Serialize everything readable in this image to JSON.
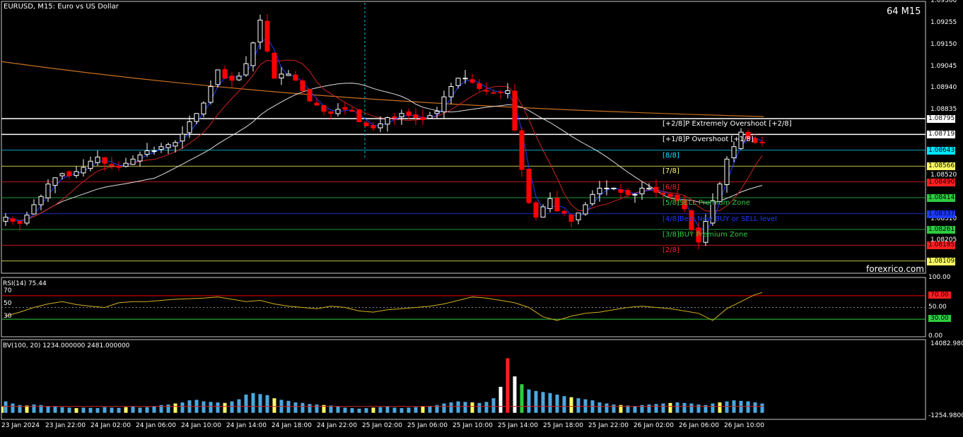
{
  "chart_title": "EURUSD, M15:  Euro vs US Dollar",
  "timeframe_badge": "64 M15",
  "watermark": "forexrico.com",
  "colors": {
    "background": "#000000",
    "bull": "#ffffff",
    "bear": "#ff0000",
    "ma_red": "#cc2222",
    "ma_orange": "#c87020",
    "ma_white": "#dddddd",
    "ma_blue": "#1a3cff",
    "rsi_line": "#d4b020",
    "rsi_70": "#ff0000",
    "rsi_30": "#2ecc40"
  },
  "price_axis": [
    "1.09360",
    "1.09255",
    "1.09150",
    "1.09045",
    "1.08940",
    "1.08835",
    "1.08520",
    "1.08310",
    "1.08205"
  ],
  "price_labels": [
    {
      "text": "1.08795",
      "bg": "#ffffff",
      "fg": "#000000"
    },
    {
      "text": "1.08719",
      "bg": "#ffffff",
      "fg": "#000000"
    },
    {
      "text": "1.08643",
      "bg": "#00e5ff",
      "fg": "#000000"
    },
    {
      "text": "1.08566",
      "bg": "#ffff66",
      "fg": "#000000"
    },
    {
      "text": "1.08490",
      "bg": "#ff2020",
      "fg": "#000000"
    },
    {
      "text": "1.08414",
      "bg": "#2ecc40",
      "fg": "#000000"
    },
    {
      "text": "1.08337",
      "bg": "#1a3cff",
      "fg": "#000000"
    },
    {
      "text": "1.08261",
      "bg": "#2ecc40",
      "fg": "#000000"
    },
    {
      "text": "1.08185",
      "bg": "#ff2020",
      "fg": "#000000"
    },
    {
      "text": "1.08109",
      "bg": "#ffff66",
      "fg": "#000000"
    }
  ],
  "murrey_levels": [
    {
      "label": "[+2/8]P Extremely Overshoot [+2/8]",
      "color": "#ffffff"
    },
    {
      "label": "[+1/8]P Overshoot [+1/8]",
      "color": "#ffffff"
    },
    {
      "label": "[8/8]",
      "color": "#00e5ff"
    },
    {
      "label": "[7/8]",
      "color": "#ffff66"
    },
    {
      "label": "[6/8]",
      "color": "#ff2020"
    },
    {
      "label": "[5/8]SELL Premium Zone",
      "color": "#2ecc40"
    },
    {
      "label": "[4/8]Best New BUY or SELL level",
      "color": "#1a3cff"
    },
    {
      "label": "[3/8]BUY Premium Zone",
      "color": "#2ecc40"
    },
    {
      "label": "[2/8]",
      "color": "#ff2020"
    }
  ],
  "rsi": {
    "title": "RSI(14) 75.44",
    "left_labels": [
      "70",
      "50",
      "30"
    ],
    "axis": [
      "100.00",
      "70.00",
      "50.00",
      "30.00",
      "0.00"
    ]
  },
  "volume": {
    "title": "BV(100, 20) 1234.000000 2481.000000",
    "axis": [
      "14082.9800",
      "-1254.9800"
    ]
  },
  "time_axis": [
    "23 Jan 2024",
    "23 Jan 22:00",
    "24 Jan 02:00",
    "24 Jan 06:00",
    "24 Jan 10:00",
    "24 Jan 14:00",
    "24 Jan 18:00",
    "24 Jan 22:00",
    "25 Jan 02:00",
    "25 Jan 06:00",
    "25 Jan 10:00",
    "25 Jan 14:00",
    "25 Jan 18:00",
    "25 Jan 22:00",
    "26 Jan 02:00",
    "26 Jan 06:00",
    "26 Jan 10:00"
  ],
  "chart_data": [
    {
      "type": "line",
      "title": "EURUSD, M15:  Euro vs US Dollar",
      "note_series": "approximate close path",
      "x": [
        0,
        10,
        20,
        30,
        40,
        50,
        60,
        70,
        80,
        90,
        100,
        110,
        120,
        130,
        140,
        150,
        160,
        170,
        180,
        190,
        200,
        210,
        220,
        230,
        240,
        250,
        260,
        270,
        280,
        290,
        300,
        310,
        320,
        330,
        340,
        350,
        360,
        370,
        380,
        390,
        400,
        410,
        420,
        430,
        440,
        450,
        460,
        470,
        480,
        490,
        500,
        510,
        520,
        530,
        540,
        550,
        560,
        570,
        580,
        590,
        600,
        610,
        620,
        630,
        640,
        650,
        660,
        670,
        680,
        690,
        700,
        710,
        720,
        730,
        740,
        750,
        760,
        770,
        780,
        790,
        800,
        810,
        820,
        830,
        840,
        850,
        860,
        870,
        880,
        890,
        900,
        910,
        920,
        930,
        940,
        950,
        960,
        970,
        980,
        990,
        1000,
        1010,
        1020,
        1030,
        1040,
        1050,
        1060,
        1070
      ],
      "series": [
        {
          "values": [
            1.0832,
            1.083,
            1.0829,
            1.0833,
            1.0838,
            1.0842,
            1.0848,
            1.0851,
            1.0853,
            1.0852,
            1.0854,
            1.0856,
            1.0859,
            1.0861,
            1.0858,
            1.0857,
            1.0856,
            1.0858,
            1.086,
            1.0862,
            1.0864,
            1.0864,
            1.0866,
            1.0867,
            1.0868,
            1.0872,
            1.0878,
            1.0882,
            1.0887,
            1.0895,
            1.0903,
            1.0899,
            1.0898,
            1.09,
            1.0906,
            1.0916,
            1.0927,
            1.0912,
            1.0899,
            1.0901,
            1.0901,
            1.0898,
            1.0893,
            1.0888,
            1.0886,
            1.0883,
            1.0882,
            1.0884,
            1.0884,
            1.0883,
            1.0878,
            1.0876,
            1.0875,
            1.0877,
            1.088,
            1.088,
            1.0882,
            1.0881,
            1.088,
            1.0879,
            1.0881,
            1.0883,
            1.089,
            1.0895,
            1.0899,
            1.0899,
            1.0897,
            1.0894,
            1.0893,
            1.0892,
            1.0892,
            1.0893,
            1.0874,
            1.0855,
            1.0839,
            1.0832,
            1.0837,
            1.0841,
            1.0835,
            1.0834,
            1.083,
            1.0834,
            1.0838,
            1.0843,
            1.0846,
            1.0846,
            1.0846,
            1.0844,
            1.0843,
            1.0843,
            1.0846,
            1.0846,
            1.0844,
            1.0843,
            1.0842,
            1.084,
            1.0836,
            1.0826,
            1.082,
            1.083,
            1.084,
            1.0848,
            1.086,
            1.0866,
            1.0873,
            1.087,
            1.0868,
            1.0868
          ]
        }
      ],
      "ylim": [
        1.0805,
        1.0936
      ]
    },
    {
      "type": "line",
      "title": "RSI(14) 75.44",
      "x": [
        0,
        20,
        40,
        60,
        80,
        100,
        120,
        140,
        160,
        180,
        200,
        220,
        240,
        260,
        280,
        300,
        320,
        340,
        360,
        380,
        400,
        420,
        440,
        460,
        480,
        500,
        520,
        540,
        560,
        580,
        600,
        620,
        640,
        660,
        680,
        700,
        720,
        740,
        760,
        780,
        800,
        820,
        840,
        860,
        880,
        900,
        920,
        940,
        960,
        980,
        1000,
        1020,
        1040,
        1060,
        1070
      ],
      "series": [
        {
          "values": [
            35,
            42,
            50,
            56,
            60,
            55,
            52,
            50,
            58,
            60,
            60,
            62,
            64,
            65,
            66,
            68,
            64,
            60,
            62,
            56,
            52,
            50,
            48,
            52,
            50,
            44,
            42,
            46,
            48,
            50,
            52,
            56,
            62,
            68,
            66,
            62,
            58,
            50,
            34,
            28,
            35,
            40,
            42,
            46,
            50,
            52,
            50,
            48,
            44,
            40,
            28,
            48,
            60,
            72,
            75.44
          ]
        }
      ],
      "ylim": [
        0,
        100
      ]
    },
    {
      "type": "bar",
      "title": "BV(100, 20) 1234.000000 2481.000000",
      "x": [
        0,
        10,
        20,
        30,
        40,
        50,
        60,
        70,
        80,
        90,
        100,
        110,
        120,
        130,
        140,
        150,
        160,
        170,
        180,
        190,
        200,
        210,
        220,
        230,
        240,
        250,
        260,
        270,
        280,
        290,
        300,
        310,
        320,
        330,
        340,
        350,
        360,
        370,
        380,
        390,
        400,
        410,
        420,
        430,
        440,
        450,
        460,
        470,
        480,
        490,
        500,
        510,
        520,
        530,
        540,
        550,
        560,
        570,
        580,
        590,
        600,
        610,
        620,
        630,
        640,
        650,
        660,
        670,
        680,
        690,
        700,
        710,
        720,
        730,
        740,
        750,
        760,
        770,
        780,
        790,
        800,
        810,
        820,
        830,
        840,
        850,
        860,
        870,
        880,
        890,
        900,
        910,
        920,
        930,
        940,
        950,
        960,
        970,
        980,
        990,
        1000,
        1010,
        1020,
        1030,
        1040,
        1050,
        1060,
        1070
      ],
      "values": [
        2200,
        1800,
        1500,
        1400,
        1600,
        1500,
        1300,
        1200,
        1100,
        1000,
        900,
        1000,
        950,
        900,
        1100,
        1000,
        950,
        1100,
        1200,
        1000,
        1100,
        1300,
        1500,
        1600,
        1800,
        2000,
        2400,
        2500,
        2200,
        2100,
        2000,
        1900,
        2200,
        2600,
        3500,
        3800,
        3600,
        3400,
        2800,
        2500,
        2300,
        2000,
        1900,
        1700,
        1600,
        1500,
        1400,
        1200,
        1000,
        900,
        800,
        900,
        1000,
        1100,
        1200,
        1000,
        900,
        1000,
        1100,
        1200,
        1300,
        1500,
        1800,
        2000,
        2200,
        2100,
        2000,
        1900,
        2100,
        2800,
        5000,
        10500,
        7000,
        5500,
        4500,
        4200,
        4000,
        3800,
        3500,
        3200,
        3000,
        2800,
        2600,
        2400,
        2000,
        1800,
        1600,
        1500,
        1400,
        1300,
        1500,
        1600,
        1700,
        1800,
        1900,
        2000,
        1900,
        1800,
        1600,
        1500,
        1800,
        2000,
        2200,
        2400,
        2300,
        2200,
        2000,
        1800,
        1234
      ],
      "ylim": [
        -1254.98,
        14082.98
      ]
    }
  ]
}
